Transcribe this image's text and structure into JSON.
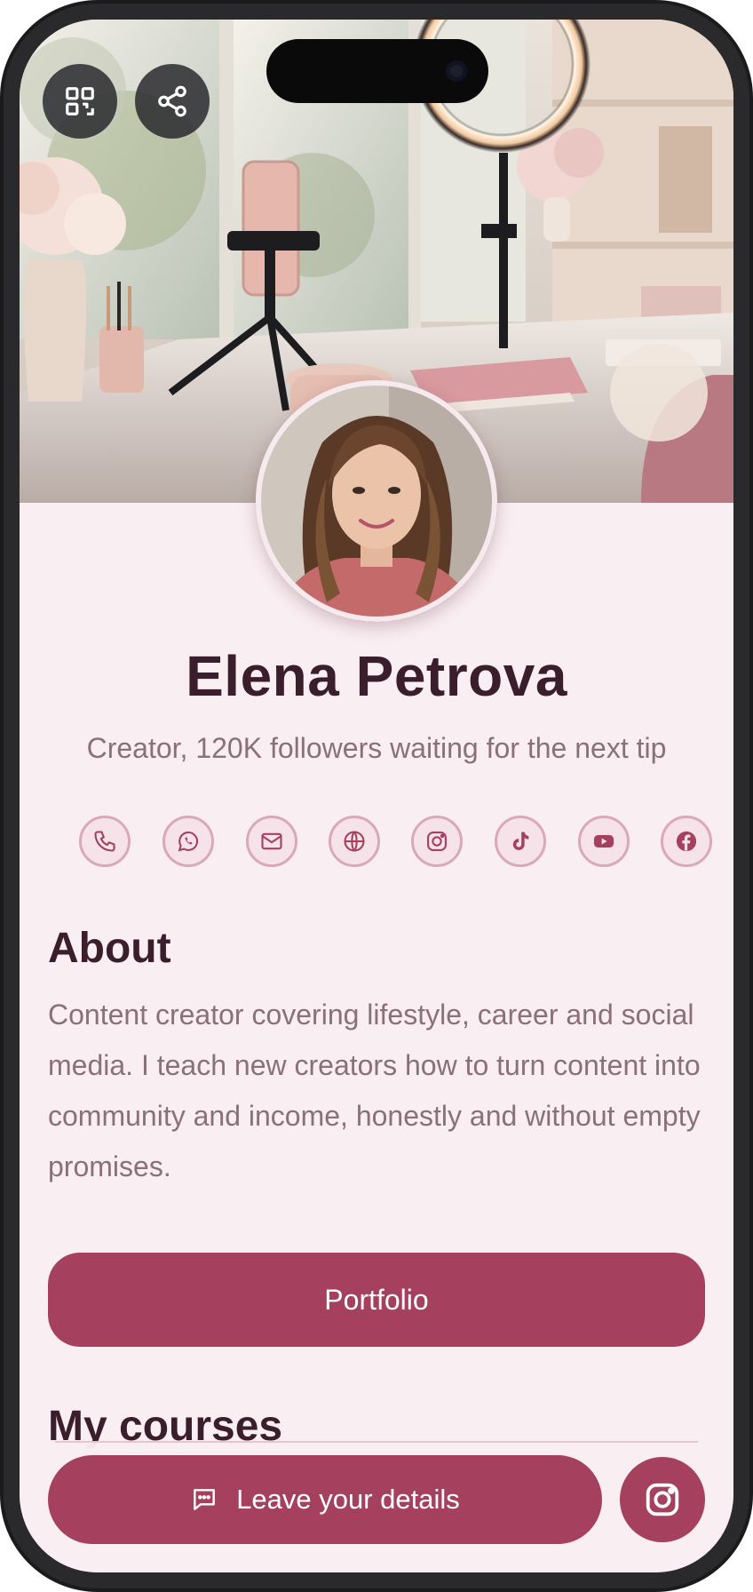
{
  "profile": {
    "name": "Elena Petrova",
    "subtitle": "Creator, 120K followers waiting for the next tip"
  },
  "top_buttons": [
    {
      "icon": "qr-code-icon"
    },
    {
      "icon": "share-icon"
    }
  ],
  "social_links": [
    {
      "icon": "phone-icon"
    },
    {
      "icon": "whatsapp-icon"
    },
    {
      "icon": "mail-icon"
    },
    {
      "icon": "globe-icon"
    },
    {
      "icon": "instagram-icon"
    },
    {
      "icon": "tiktok-icon"
    },
    {
      "icon": "youtube-icon"
    },
    {
      "icon": "facebook-icon"
    }
  ],
  "about": {
    "heading": "About",
    "text": "Content creator covering lifestyle, career and social media. I teach new creators how to turn content into community and income, honestly and without empty promises."
  },
  "portfolio_button": "Portfolio",
  "courses": {
    "heading": "My courses"
  },
  "footer": {
    "leave_details": "Leave your details",
    "leave_icon": "chat-icon",
    "fab_icon": "instagram-icon"
  },
  "colors": {
    "accent": "#a5405f",
    "background": "#f9eef2",
    "heading": "#3a1e2c",
    "muted_text": "#8a7077",
    "icon_border": "#d9a9b6"
  }
}
